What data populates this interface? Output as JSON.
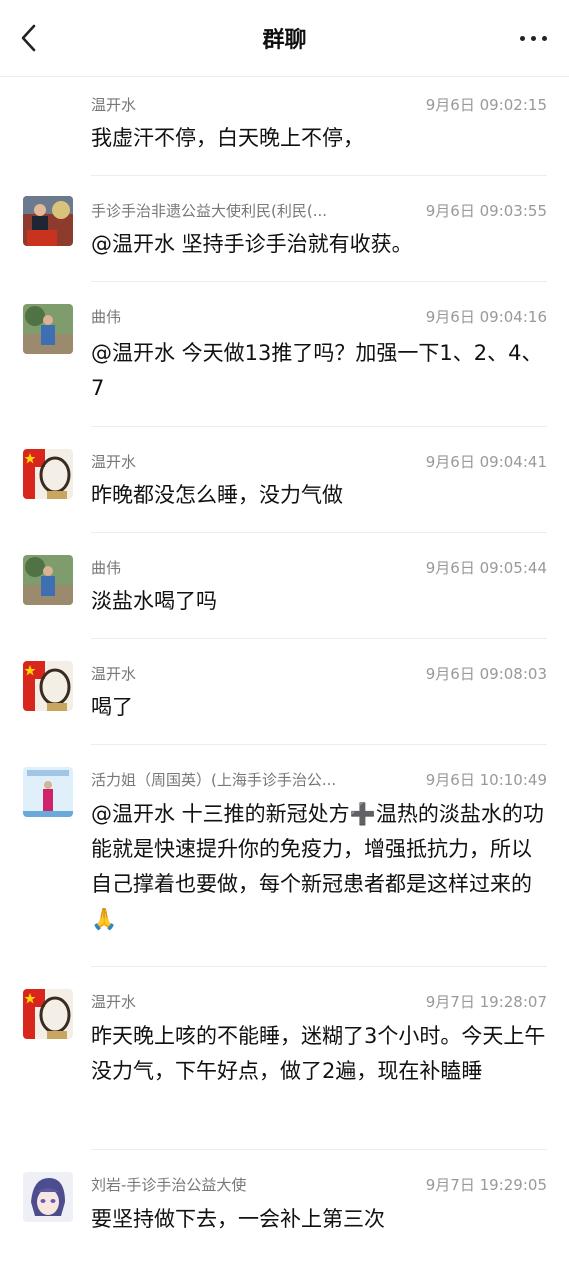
{
  "header": {
    "title": "群聊"
  },
  "messages": [
    {
      "name": "温开水",
      "time": "9月6日 09:02:15",
      "text": "我虚汗不停，白天晚上不停，",
      "avatar": "none"
    },
    {
      "name": "手诊手治非遗公益大使利民(利民(...",
      "time": "9月6日 09:03:55",
      "text": "@温开水 坚持手诊手治就有收获。",
      "avatar": "podium"
    },
    {
      "name": "曲伟",
      "time": "9月6日 09:04:16",
      "text": "@温开水 今天做13推了吗？加强一下1、2、4、7",
      "avatar": "person-outdoor"
    },
    {
      "name": "温开水",
      "time": "9月6日 09:04:41",
      "text": "昨晚都没怎么睡，没力气做",
      "avatar": "flag-circle"
    },
    {
      "name": "曲伟",
      "time": "9月6日 09:05:44",
      "text": "淡盐水喝了吗",
      "avatar": "person-outdoor"
    },
    {
      "name": "温开水",
      "time": "9月6日 09:08:03",
      "text": "喝了",
      "avatar": "flag-circle"
    },
    {
      "name": "活力姐（周国英）(上海手诊手治公...",
      "time": "9月6日 10:10:49",
      "text": "@温开水 十三推的新冠处方➕温热的淡盐水的功能就是快速提升你的免疫力，增强抵抗力，所以自己撑着也要做，每个新冠患者都是这样过来的🙏",
      "avatar": "person-event"
    },
    {
      "name": "温开水",
      "time": "9月7日 19:28:07",
      "text": "昨天晚上咳的不能睡，迷糊了3个小时。今天上午没力气，下午好点，做了2遍，现在补瞌睡",
      "avatar": "flag-circle"
    },
    {
      "name": "刘岩-手诊手治公益大使",
      "time": "9月7日 19:29:05",
      "text": "要坚持做下去，一会补上第三次",
      "avatar": "anime"
    }
  ]
}
